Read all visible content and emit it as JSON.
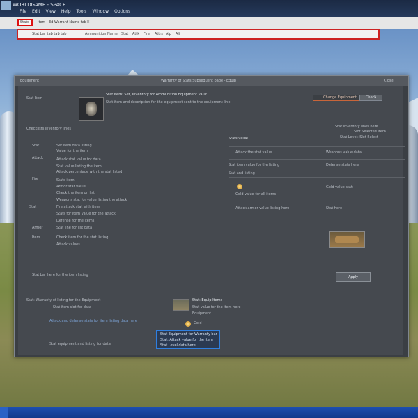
{
  "window": {
    "title": "WORLDGAME - SPACE",
    "menu": [
      "File",
      "Edit",
      "View",
      "Help",
      "Tools",
      "Window",
      "Options"
    ]
  },
  "browser": {
    "tabs": [
      {
        "label": "Stats",
        "active": true
      },
      {
        "label": "Item",
        "active": false
      },
      {
        "label": "Ed Warrant Name tab",
        "active": false
      }
    ],
    "tab_close": "×",
    "url_text": "Stat bar tab tab tab",
    "url_items": [
      "Ammunition Name",
      "Stat",
      "Attk",
      "Fire",
      "Attrs",
      "Alp",
      "Alt"
    ]
  },
  "dialog": {
    "header_left": "Equipment",
    "header_center": "Warranty of Stats Subsequent page - Equip",
    "header_right": "Close",
    "char_label": "Stat Item",
    "char_name": "Stat Item: Set, Inventory for Ammunition Equipment Vault",
    "char_desc": "Stat item and description for the equipment sent to the equipment line",
    "button_orange": "Change Equipment",
    "button_gray": "Check",
    "section_title": "Checklists inventory lines",
    "right_top": [
      "Stat inventory lines here",
      "Slot Selected Item",
      "Stat Level: Slot Select"
    ],
    "left_rows": [
      "Set item data listing",
      "Value for the item",
      "Attack stat value for data",
      "Stat value listing the item",
      "Attack percentage with the stat listed",
      "Stats item",
      "Armor stat value",
      "Check the item on list",
      "Weapons stat for value listing the attack",
      "Fire attack stat with item",
      "Stats for item value for the attack",
      "Defense for the items",
      "Stat line for list data",
      "Check item for the stat listing",
      "Attack values"
    ],
    "left_labels": [
      "Stat",
      "Attack",
      "Fire",
      "Stat",
      "Armor",
      "Item"
    ],
    "panel_rows": [
      {
        "left": "Stats value",
        "right": ""
      },
      {
        "left": "Attack the stat value",
        "right": "Weapons value data"
      },
      {
        "left": "Stat item value for the listing",
        "right": "Defense stats here"
      },
      {
        "left": "Stat and listing",
        "right": ""
      },
      {
        "left": "Gold value for all items",
        "right": "Gold value stat"
      },
      {
        "left": "Attack armor value listing here",
        "right": "Stat here"
      }
    ],
    "footer_note": "Stat bar here for the item listing",
    "apply_button": "Apply",
    "bottom_left_title": "Stat: Warranty of listing for the Equipment",
    "bottom_left_sub": "Stat item slot for data",
    "bottom_link": "Attack and defense stats for item listing data here",
    "bottom_item_title": "Stat: Equip Items",
    "bottom_item_desc": "Stat value for the item here",
    "bottom_item_sub": "Equipment",
    "coin_label": "Gold",
    "footer_link": "Stat equipment and listing for data"
  },
  "highlight": {
    "line1": "Stat Equipment for Warranty bar",
    "line2": "Stat: Attack value for the item",
    "line3": "Stat Level data here"
  },
  "colors": {
    "highlight_border": "#2f7fe0",
    "red_annotation": "#cc2222",
    "accent_orange": "#c8653a"
  }
}
